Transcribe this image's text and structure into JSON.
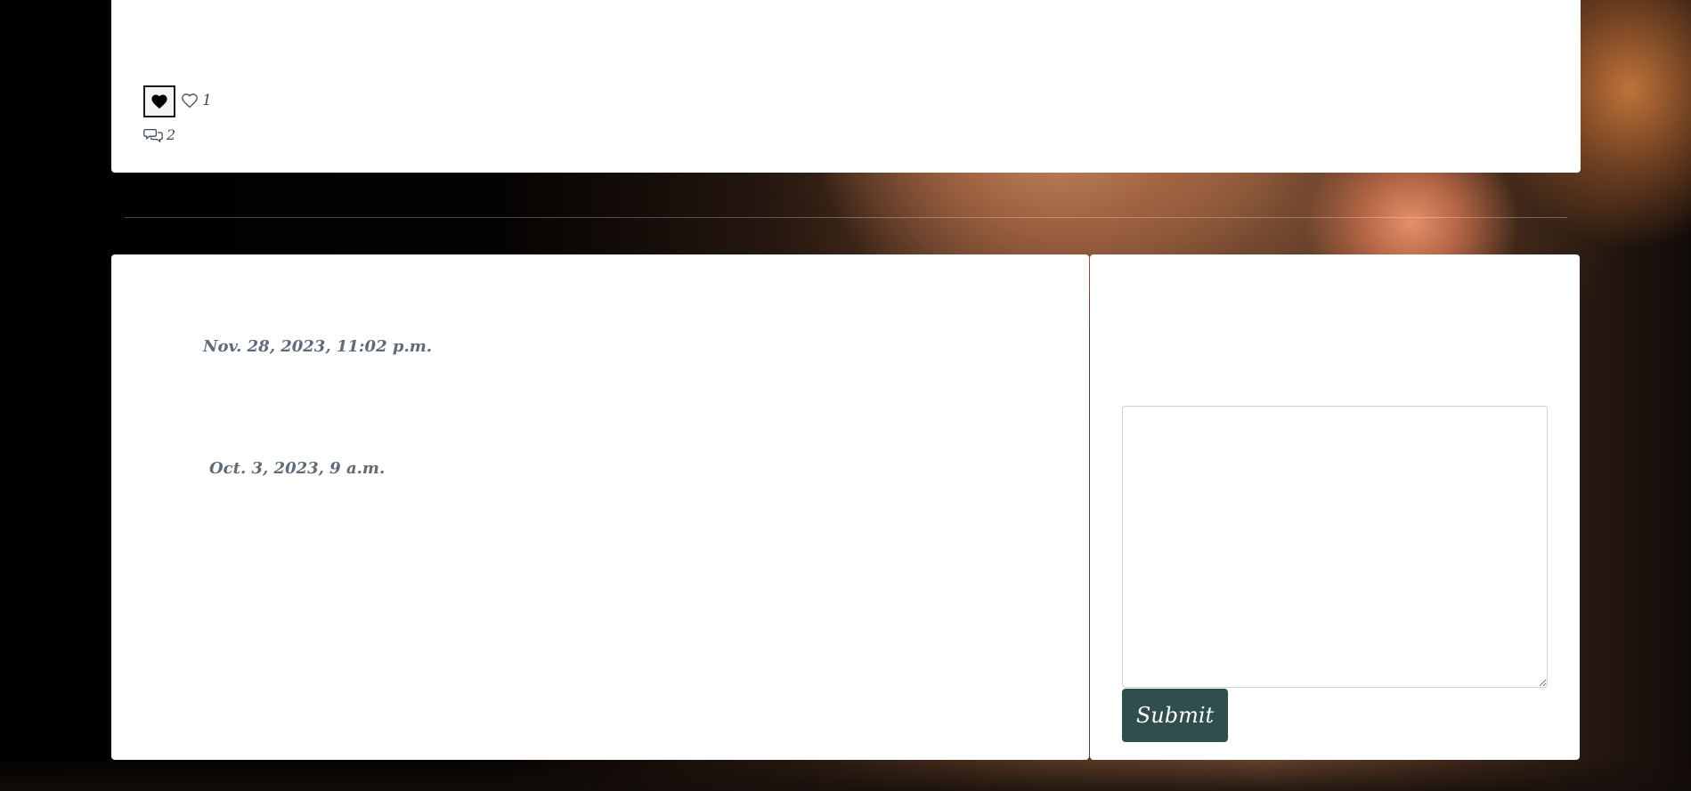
{
  "post": {
    "like_count": "1",
    "comment_count": "2",
    "icons": {
      "like_button": "heart-filled-icon",
      "likes": "heart-outline-icon",
      "comments": "chat-bubbles-icon"
    }
  },
  "comments": [
    {
      "date": "Nov. 28, 2023, 11:02 p.m."
    },
    {
      "date": "Oct. 3, 2023, 9 a.m."
    }
  ],
  "comment_form": {
    "text_value": "",
    "submit_label": "Submit"
  },
  "colors": {
    "submit_bg": "#2f4e4d",
    "meta_text": "#5e6b78"
  }
}
